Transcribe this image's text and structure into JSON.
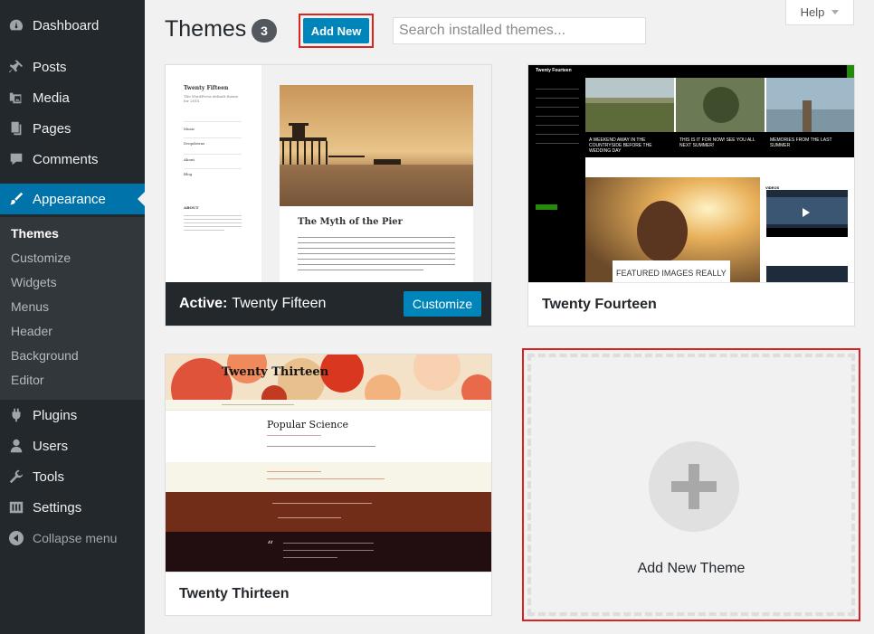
{
  "sidebar": {
    "items": [
      {
        "label": "Dashboard",
        "icon": "dashboard-icon"
      },
      {
        "label": "Posts",
        "icon": "pin-icon"
      },
      {
        "label": "Media",
        "icon": "media-icon"
      },
      {
        "label": "Pages",
        "icon": "pages-icon"
      },
      {
        "label": "Comments",
        "icon": "comment-icon"
      },
      {
        "label": "Appearance",
        "icon": "paintbrush-icon",
        "current": true
      },
      {
        "label": "Plugins",
        "icon": "plugin-icon"
      },
      {
        "label": "Users",
        "icon": "users-icon"
      },
      {
        "label": "Tools",
        "icon": "wrench-icon"
      },
      {
        "label": "Settings",
        "icon": "settings-icon"
      }
    ],
    "submenu": [
      "Themes",
      "Customize",
      "Widgets",
      "Menus",
      "Header",
      "Background",
      "Editor"
    ],
    "collapse_label": "Collapse menu"
  },
  "header": {
    "title": "Themes",
    "count": "3",
    "add_new": "Add New",
    "search_placeholder": "Search installed themes...",
    "help": "Help"
  },
  "themes": [
    {
      "name": "Twenty Fifteen",
      "active_label": "Active:",
      "customize": "Customize",
      "preview": {
        "site_title": "Twenty Fifteen",
        "tagline": "The WordPress default theme for 2015.",
        "widgets": [
          "Music",
          "Dropdowns",
          "About",
          "Blog",
          "ABOUT"
        ],
        "post_title": "The Myth of the Pier"
      }
    },
    {
      "name": "Twenty Fourteen",
      "preview": {
        "site_title": "Twenty Fourteen",
        "captions": [
          "A WEEKEND AWAY IN THE COUNTRYSIDE BEFORE THE WEDDING DAY",
          "THIS IS IT FOR NOW! SEE YOU ALL NEXT SUMMER!",
          "MEMORIES FROM THE LAST SUMMER"
        ],
        "feature": "FEATURED IMAGES REALLY",
        "videos": "VIDEOS"
      }
    },
    {
      "name": "Twenty Thirteen",
      "preview": {
        "site_title": "Twenty Thirteen",
        "post_title": "Popular Science"
      }
    }
  ],
  "add_theme": {
    "label": "Add New Theme"
  },
  "colors": {
    "accent": "#0073aa",
    "button": "#0085ba",
    "highlight": "#dd2222",
    "sidebar": "#23282d"
  }
}
